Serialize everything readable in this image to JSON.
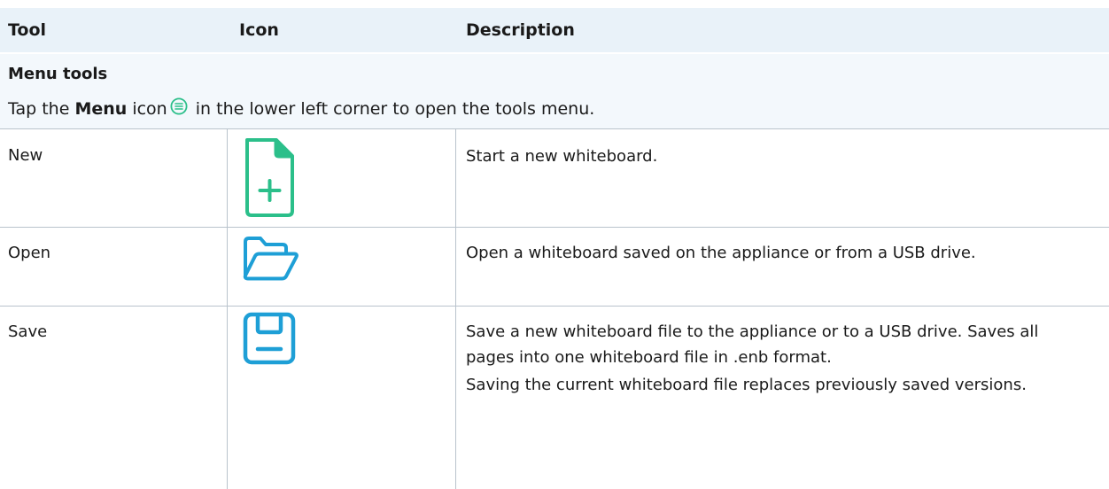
{
  "header": {
    "col_tool": "Tool",
    "col_icon": "Icon",
    "col_description": "Description"
  },
  "section": {
    "title": "Menu tools",
    "note_before": "Tap the ",
    "note_bold": "Menu",
    "note_mid": " icon",
    "note_after": " in the lower left corner to open the tools menu.",
    "inline_icon": "menu-circle-icon"
  },
  "rows": [
    {
      "tool": "New",
      "icon": "new-file-icon",
      "description": [
        "Start a new whiteboard."
      ]
    },
    {
      "tool": "Open",
      "icon": "folder-open-icon",
      "description": [
        "Open a whiteboard saved on the appliance or from a USB drive."
      ]
    },
    {
      "tool": "Save",
      "icon": "save-disk-icon",
      "description": [
        "Save a new whiteboard file to the appliance or to a USB drive. Saves all pages into one whiteboard file in .enb format.",
        "Saving the current whiteboard file replaces previously saved versions."
      ]
    }
  ],
  "colors": {
    "header_bg": "#e9f2f9",
    "section_bg": "#f3f8fc",
    "icon_green": "#2bbf8a",
    "icon_blue": "#1e9fd6",
    "rule": "#b9c3cc"
  }
}
